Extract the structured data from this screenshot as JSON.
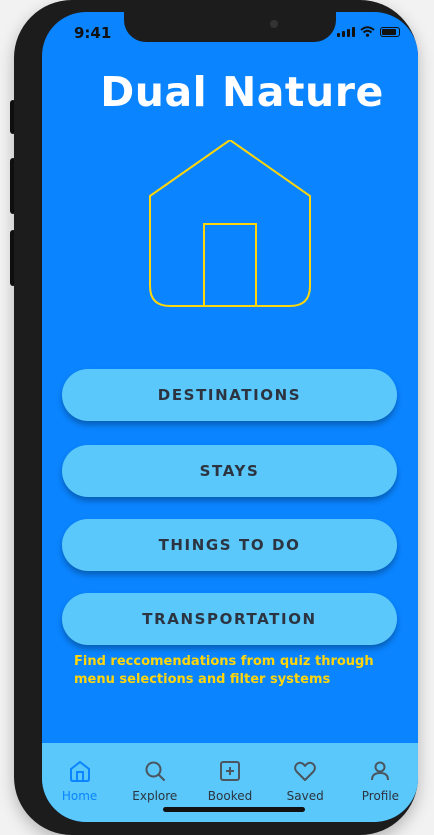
{
  "status": {
    "time": "9:41"
  },
  "app": {
    "title": "Dual Nature"
  },
  "menu": [
    {
      "label": "DESTINATIONS"
    },
    {
      "label": "STAYS"
    },
    {
      "label": "THINGS TO DO"
    },
    {
      "label": "TRANSPORTATION"
    }
  ],
  "note": "Find reccomendations from quiz through menu selections and filter systems",
  "tabs": [
    {
      "label": "Home",
      "icon": "home-icon",
      "active": true
    },
    {
      "label": "Explore",
      "icon": "search-icon"
    },
    {
      "label": "Booked",
      "icon": "plus-square-icon"
    },
    {
      "label": "Saved",
      "icon": "heart-icon"
    },
    {
      "label": "Profile",
      "icon": "user-icon"
    }
  ],
  "colors": {
    "background": "#0a84ff",
    "button": "#5ac8fa",
    "accent_yellow": "#ffd60a",
    "button_text": "#2b3440"
  }
}
